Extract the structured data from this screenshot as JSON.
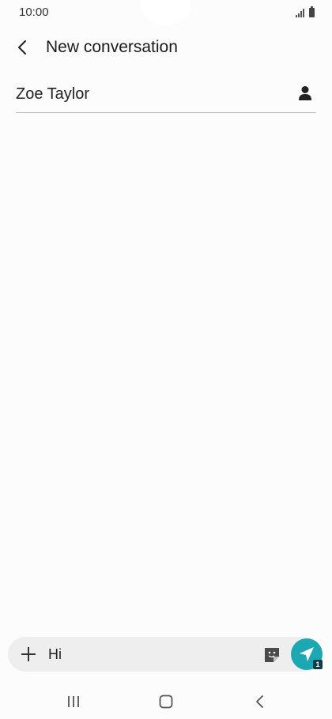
{
  "status_bar": {
    "time": "10:00",
    "signal_icon": "signal-icon",
    "battery_icon": "battery-icon"
  },
  "header": {
    "back_icon": "back-arrow-icon",
    "title": "New conversation"
  },
  "recipient": {
    "value": "Zoe Taylor",
    "contact_icon": "person-icon"
  },
  "compose": {
    "attach_icon": "plus-icon",
    "message_value": "Hi",
    "sticker_icon": "sticker-icon",
    "send_icon": "send-icon",
    "sim_badge": "1",
    "send_color": "#1ba8b3"
  },
  "nav_bar": {
    "recents_icon": "recents-icon",
    "home_icon": "home-icon",
    "back_icon": "back-icon"
  }
}
